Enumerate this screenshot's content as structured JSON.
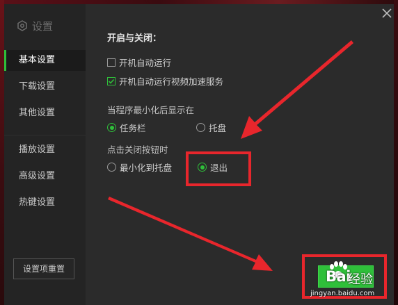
{
  "sidebar": {
    "title": "设置",
    "items": [
      {
        "label": "基本设置",
        "active": true
      },
      {
        "label": "下载设置",
        "active": false
      },
      {
        "label": "其他设置",
        "active": false
      },
      {
        "label": "播放设置",
        "active": false
      },
      {
        "label": "高级设置",
        "active": false
      },
      {
        "label": "热键设置",
        "active": false
      }
    ],
    "reset_label": "设置项重置"
  },
  "main": {
    "section_title": "开启与关闭：",
    "options": [
      {
        "label": "开机自动运行",
        "checked": false
      },
      {
        "label": "开机自动运行视频加速服务",
        "checked": true
      }
    ],
    "minimize_group": {
      "label": "当程序最小化后显示在",
      "options": [
        {
          "label": "任务栏",
          "selected": true
        },
        {
          "label": "托盘",
          "selected": false
        }
      ]
    },
    "close_group": {
      "label": "点击关闭按钮时",
      "options": [
        {
          "label": "最小化到托盘",
          "selected": false
        },
        {
          "label": "退出",
          "selected": true
        }
      ]
    }
  },
  "watermark": {
    "brand_a": "Bai",
    "brand_b": "经验",
    "url": "jingyan.baidu.com"
  },
  "colors": {
    "accent": "#2fbf3a",
    "annotation": "#e8262c",
    "background": "#2b2b2b",
    "sidebar": "#242424"
  }
}
